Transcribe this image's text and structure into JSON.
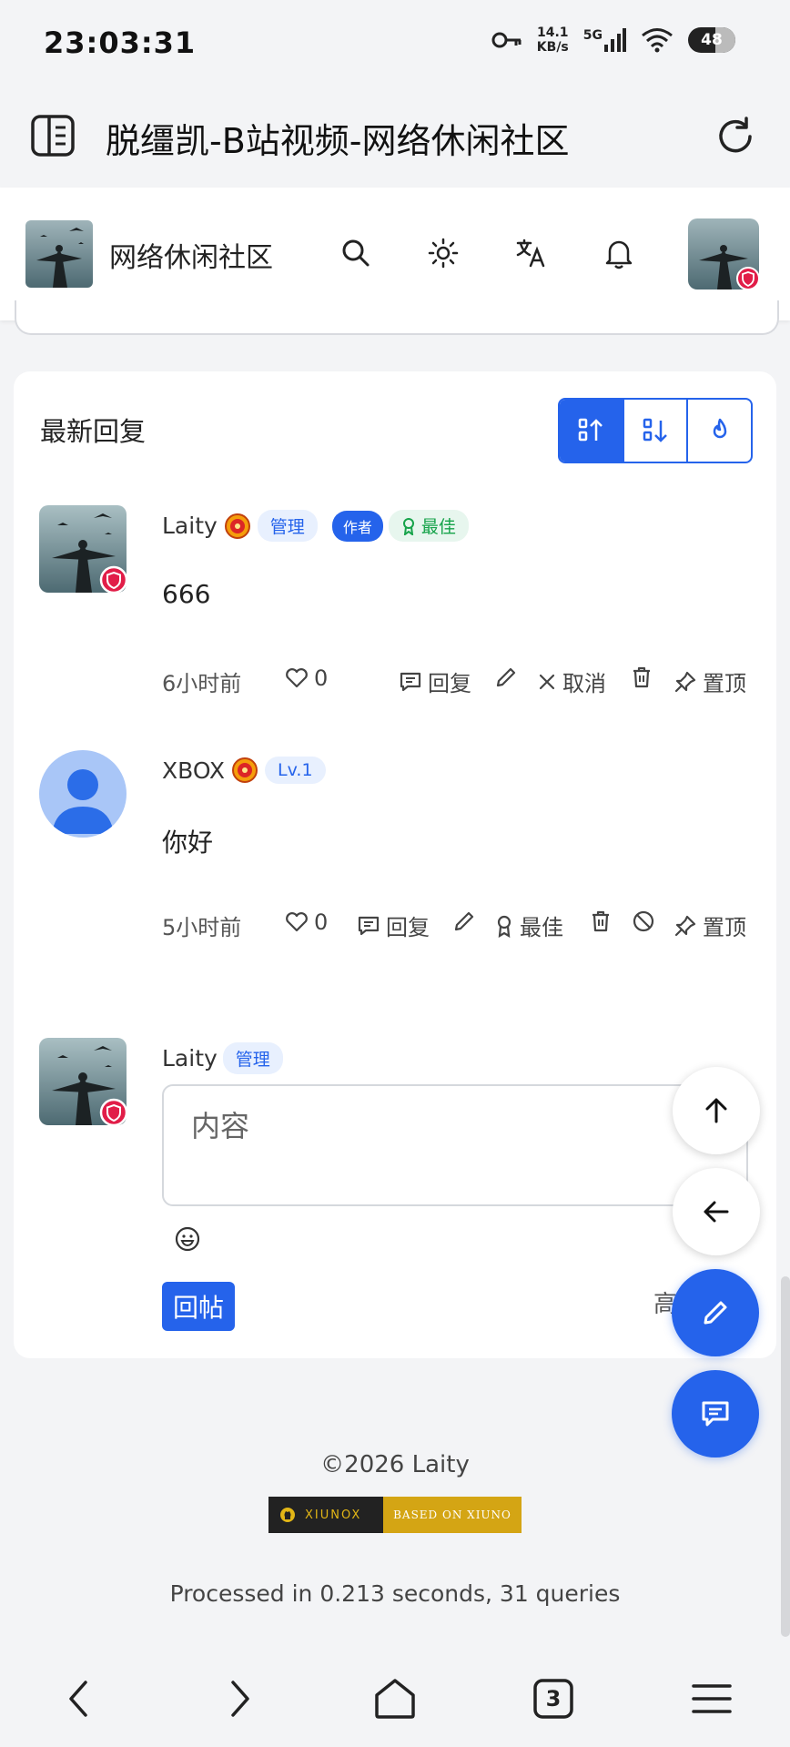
{
  "status_bar": {
    "time": "23:03:31",
    "net_speed_value": "14.1",
    "net_speed_unit": "KB/s",
    "signal_label": "5G",
    "battery": "48"
  },
  "browser": {
    "title": "脱缰凯-B站视频-网络休闲社区"
  },
  "site_header": {
    "site_name": "网络休闲社区"
  },
  "replies_section": {
    "title": "最新回复",
    "sort_buttons": [
      "sort-ascending",
      "sort-descending",
      "sort-hot"
    ]
  },
  "replies": [
    {
      "username": "Laity",
      "badges": [
        "管理",
        "作者",
        "最佳"
      ],
      "content": "666",
      "time": "6小时前",
      "likes": "0",
      "actions": {
        "reply": "回复",
        "cancel": "取消",
        "pin": "置顶"
      }
    },
    {
      "username": "XBOX",
      "badges": [
        "Lv.1"
      ],
      "content": "你好",
      "time": "5小时前",
      "likes": "0",
      "actions": {
        "reply": "回复",
        "best": "最佳",
        "pin": "置顶"
      }
    }
  ],
  "compose": {
    "username": "Laity",
    "badge": "管理",
    "placeholder": "内容",
    "submit_label": "回帖",
    "right_hint": "高"
  },
  "footer": {
    "copyright": "©2026 Laity",
    "powered_left": "XIUNOX",
    "powered_right": "BASED ON XIUNO",
    "processed": "Processed in 0.213 seconds, 31 queries"
  },
  "bottom_nav": {
    "tabs_count": "3"
  },
  "colors": {
    "accent": "#2563eb",
    "best_green": "#16a34a",
    "page_bg": "#f3f4f6"
  }
}
